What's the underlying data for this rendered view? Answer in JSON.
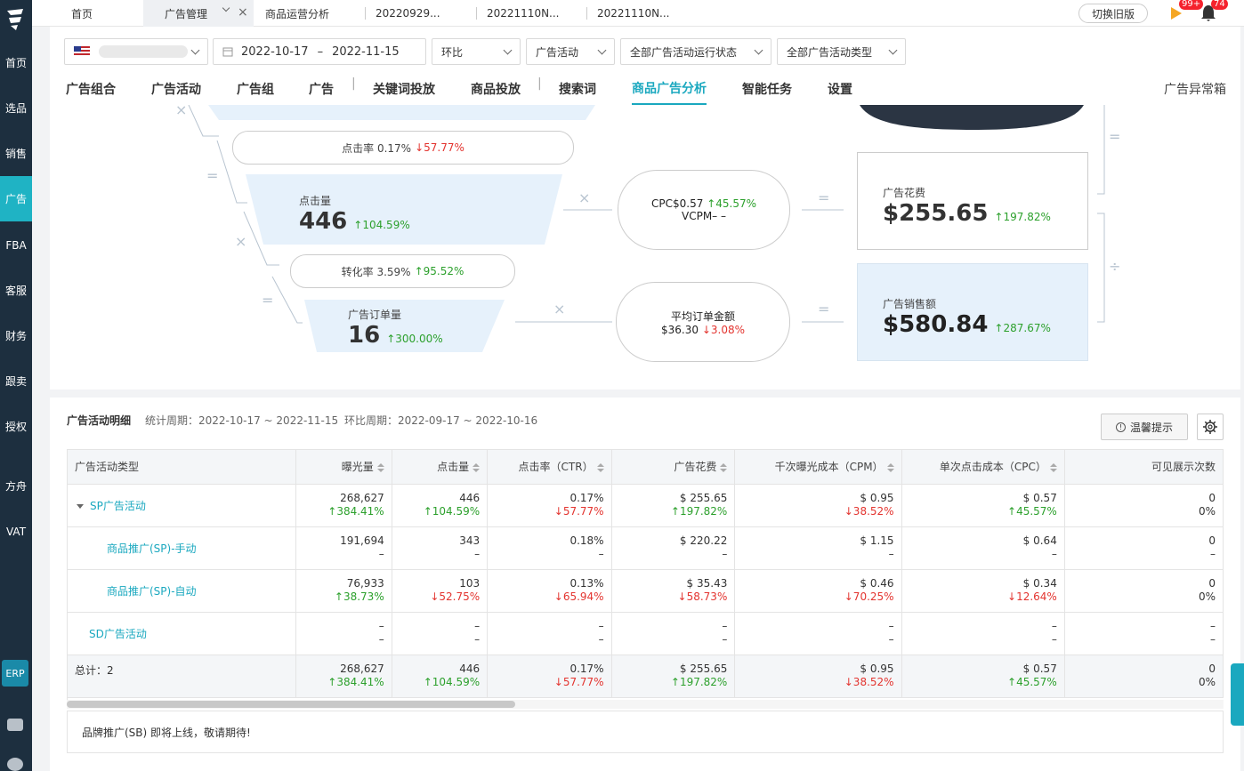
{
  "sidebar": {
    "items": [
      "首页",
      "选品",
      "销售",
      "广告",
      "FBA",
      "客服",
      "财务",
      "跟卖",
      "授权",
      "方舟",
      "VAT"
    ],
    "erp": "ERP"
  },
  "topbar": {
    "tabs": [
      {
        "label": "首页"
      },
      {
        "label": "广告管理"
      },
      {
        "label": "商品运营分析"
      },
      {
        "label": "20220929..."
      },
      {
        "label": "20221110N..."
      },
      {
        "label": "20221110N..."
      }
    ],
    "switch_old": "切换旧版",
    "flag_badge": "99+",
    "bell_badge": "74"
  },
  "filters": {
    "date_start": "2022-10-17",
    "date_sep": "–",
    "date_end": "2022-11-15",
    "compare": "环比",
    "level": "广告活动",
    "status": "全部广告活动运行状态",
    "type": "全部广告活动类型"
  },
  "nav": {
    "tabs": [
      "广告组合",
      "广告活动",
      "广告组",
      "广告",
      "关键词投放",
      "商品投放",
      "搜索词",
      "商品广告分析",
      "智能任务",
      "设置"
    ],
    "sep": "|",
    "right": "广告异常箱"
  },
  "funnel": {
    "ctr": {
      "label": "点击率 0.17%",
      "change": "↓57.77%"
    },
    "clicks": {
      "label": "点击量",
      "value": "446",
      "change": "↑104.59%"
    },
    "cvr": {
      "label": "转化率 3.59%",
      "change": "↑95.52%"
    },
    "orders": {
      "label": "广告订单量",
      "value": "16",
      "change": "↑300.00%"
    },
    "cpc": {
      "label": "CPC$0.57",
      "change": "↑45.57%",
      "vcpm": "VCPM– –"
    },
    "aov": {
      "label": "平均订单金额",
      "value": "$36.30",
      "change": "↓3.08%"
    },
    "spend": {
      "label": "广告花费",
      "value": "$255.65",
      "change": "↑197.82%"
    },
    "sales": {
      "label": "广告销售额",
      "value": "$580.84",
      "change": "↑287.67%"
    },
    "ops": {
      "times": "×",
      "eq": "=",
      "div": "÷"
    }
  },
  "detail": {
    "title": "广告活动明细",
    "period": "统计周期：2022-10-17 ~ 2022-11-15",
    "compare_period": "环比周期：2022-09-17 ~ 2022-10-16",
    "tip_button": "温馨提示",
    "columns": [
      "广告活动类型",
      "曝光量",
      "点击量",
      "点击率（CTR）",
      "广告花费",
      "千次曝光成本（CPM）",
      "单次点击成本（CPC）",
      "可见展示次数"
    ],
    "rows": [
      {
        "name": "SP广告活动",
        "cells": [
          [
            "268,627",
            "↑384.41%"
          ],
          [
            "446",
            "↑104.59%"
          ],
          [
            "0.17%",
            "↓57.77%"
          ],
          [
            "$ 255.65",
            "↑197.82%"
          ],
          [
            "$ 0.95",
            "↓38.52%"
          ],
          [
            "$ 0.57",
            "↑45.57%"
          ],
          [
            "0",
            "0%"
          ]
        ]
      },
      {
        "name": "商品推广(SP)-手动",
        "cells": [
          [
            "191,694",
            "–"
          ],
          [
            "343",
            "–"
          ],
          [
            "0.18%",
            "–"
          ],
          [
            "$ 220.22",
            "–"
          ],
          [
            "$ 1.15",
            "–"
          ],
          [
            "$ 0.64",
            "–"
          ],
          [
            "0",
            "–"
          ]
        ]
      },
      {
        "name": "商品推广(SP)-自动",
        "cells": [
          [
            "76,933",
            "↑38.73%"
          ],
          [
            "103",
            "↓52.75%"
          ],
          [
            "0.13%",
            "↓65.94%"
          ],
          [
            "$ 35.43",
            "↓58.73%"
          ],
          [
            "$ 0.46",
            "↓70.25%"
          ],
          [
            "$ 0.34",
            "↓12.64%"
          ],
          [
            "0",
            "0%"
          ]
        ]
      },
      {
        "name": "SD广告活动",
        "cells": [
          [
            "–",
            "–"
          ],
          [
            "–",
            "–"
          ],
          [
            "–",
            "–"
          ],
          [
            "–",
            "–"
          ],
          [
            "–",
            "–"
          ],
          [
            "–",
            "–"
          ],
          [
            "–",
            "–"
          ]
        ]
      }
    ],
    "total": {
      "name": "总计：2",
      "cells": [
        [
          "268,627",
          "↑384.41%"
        ],
        [
          "446",
          "↑104.59%"
        ],
        [
          "0.17%",
          "↓57.77%"
        ],
        [
          "$ 255.65",
          "↑197.82%"
        ],
        [
          "$ 0.95",
          "↓38.52%"
        ],
        [
          "$ 0.57",
          "↑45.57%"
        ],
        [
          "0",
          "0%"
        ]
      ]
    },
    "sb_notice": "品牌推广(SB) 即将上线，敬请期待!"
  }
}
